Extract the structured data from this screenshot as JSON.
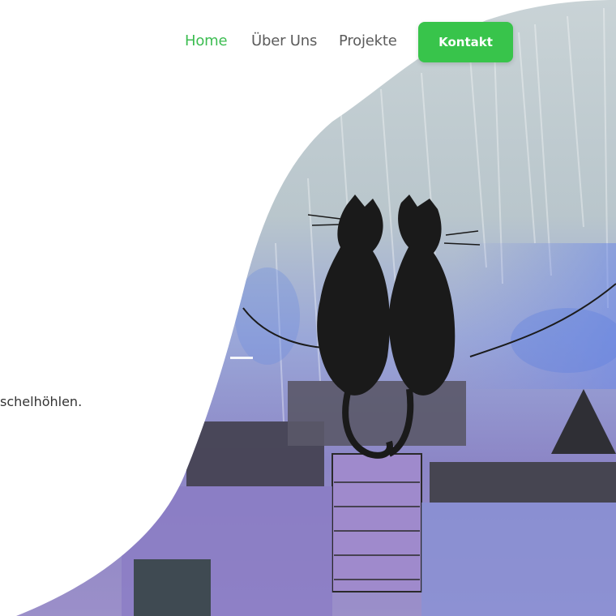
{
  "nav": {
    "items": [
      {
        "label": "Home",
        "active": true
      },
      {
        "label": "Über Uns",
        "active": false
      },
      {
        "label": "Projekte",
        "active": false
      }
    ],
    "cta_label": "Kontakt"
  },
  "hero": {
    "text_fragment": "schelhöhlen."
  },
  "colors": {
    "accent": "#38c44b",
    "nav_text": "#5c5c5c",
    "nav_active": "#3dbd52"
  },
  "hero_image": {
    "subject": "painting of two black cats on a rooftop chimney under a purple-blue sky"
  }
}
